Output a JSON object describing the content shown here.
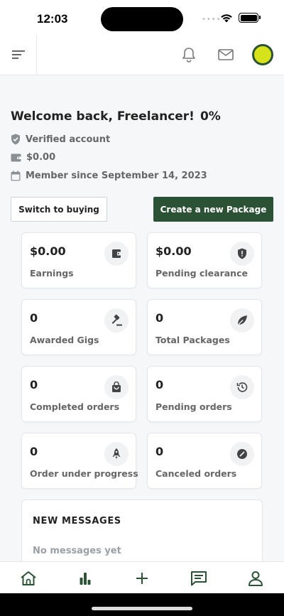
{
  "status_bar": {
    "time": "12:03"
  },
  "header": {
    "menu_icon": "hamburger-menu-icon",
    "notification_icon": "bell-icon",
    "messages_icon": "mail-icon",
    "avatar_color": "#d6e31a"
  },
  "welcome": {
    "greeting": "Welcome back, Freelancer!",
    "completion": "0%",
    "verified": "Verified account",
    "balance": "$0.00",
    "member_since": "Member since September 14, 2023"
  },
  "actions": {
    "switch_label": "Switch to buying",
    "create_label": "Create a new Package"
  },
  "stats": [
    {
      "value": "$0.00",
      "label": "Earnings",
      "icon": "wallet-icon"
    },
    {
      "value": "$0.00",
      "label": "Pending clearance",
      "icon": "shield-alert-icon"
    },
    {
      "value": "0",
      "label": "Awarded Gigs",
      "icon": "gavel-icon"
    },
    {
      "value": "0",
      "label": "Total Packages",
      "icon": "leaf-icon"
    },
    {
      "value": "0",
      "label": "Completed orders",
      "icon": "shopping-bag-icon"
    },
    {
      "value": "0",
      "label": "Pending orders",
      "icon": "history-icon"
    },
    {
      "value": "0",
      "label": "Order under progress",
      "icon": "rocket-icon"
    },
    {
      "value": "0",
      "label": "Canceled orders",
      "icon": "cancel-circle-icon"
    }
  ],
  "messages": {
    "title": "NEW MESSAGES",
    "empty_text": "No messages yet"
  },
  "bottom_nav": [
    "home-icon",
    "stats-chart-icon",
    "plus-icon",
    "chat-icon",
    "profile-icon"
  ],
  "colors": {
    "brand": "#2b5235",
    "background": "#f5f7f9",
    "muted_text": "#666666"
  }
}
